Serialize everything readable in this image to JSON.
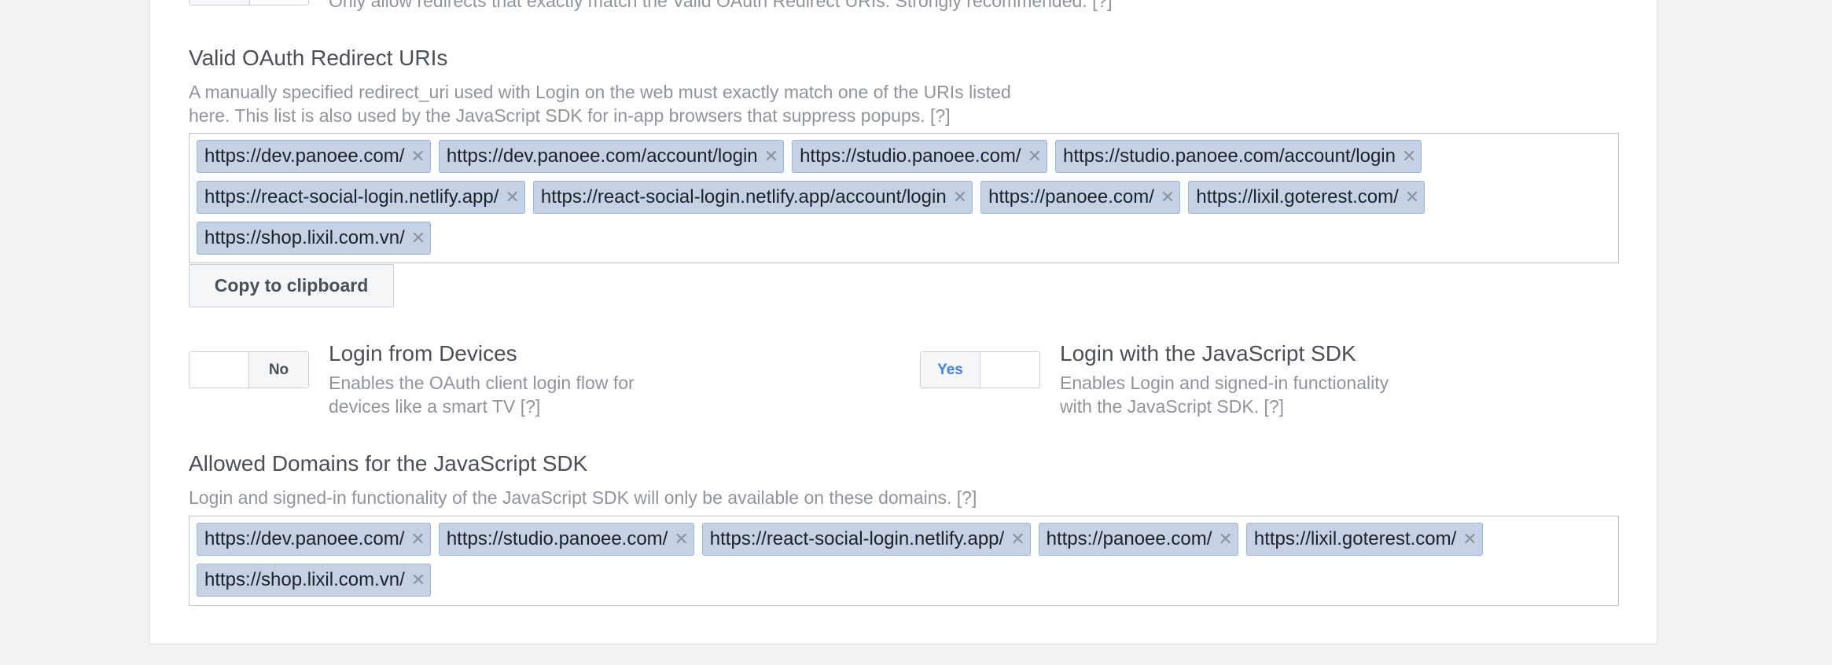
{
  "top_option": {
    "description": "Only allow redirects that exactly match the Valid OAuth Redirect URIs. Strongly recommended.  [?]"
  },
  "redirect_uris": {
    "title": "Valid OAuth Redirect URIs",
    "description_line1": "A manually specified redirect_uri used with Login on the web must exactly match one of the URIs listed",
    "description_line2": "here. This list is also used by the JavaScript SDK for in-app browsers that suppress popups.  [?]",
    "tags": [
      {
        "label": "https://dev.panoee.com/"
      },
      {
        "label": "https://dev.panoee.com/account/login"
      },
      {
        "label": "https://studio.panoee.com/"
      },
      {
        "label": "https://studio.panoee.com/account/login"
      },
      {
        "label": "https://react-social-login.netlify.app/"
      },
      {
        "label": "https://react-social-login.netlify.app/account/login"
      },
      {
        "label": "https://panoee.com/"
      },
      {
        "label": "https://lixil.goterest.com/"
      },
      {
        "label": "https://shop.lixil.com.vn/"
      }
    ],
    "copy_label": "Copy to clipboard"
  },
  "login_devices": {
    "title": "Login from Devices",
    "description_line1": "Enables the OAuth client login flow for",
    "description_line2": "devices like a smart TV [?]",
    "toggle_label": "No"
  },
  "login_js_sdk": {
    "title": "Login with the JavaScript SDK",
    "description_line1": "Enables Login and signed-in functionality",
    "description_line2": "with the JavaScript SDK.  [?]",
    "toggle_label": "Yes"
  },
  "allowed_domains": {
    "title": "Allowed Domains for the JavaScript SDK",
    "description": "Login and signed-in functionality of the JavaScript SDK will only be available on these domains.  [?]",
    "tags": [
      {
        "label": "https://dev.panoee.com/"
      },
      {
        "label": "https://studio.panoee.com/"
      },
      {
        "label": "https://react-social-login.netlify.app/"
      },
      {
        "label": "https://panoee.com/"
      },
      {
        "label": "https://lixil.goterest.com/"
      },
      {
        "label": "https://shop.lixil.com.vn/"
      }
    ]
  },
  "icons": {
    "remove": "close-icon",
    "remove_glyph": "✕"
  },
  "colors": {
    "tag_bg": "#c6d1e6",
    "tag_border": "#9cb4d8",
    "accent_yes": "#4080ff"
  }
}
